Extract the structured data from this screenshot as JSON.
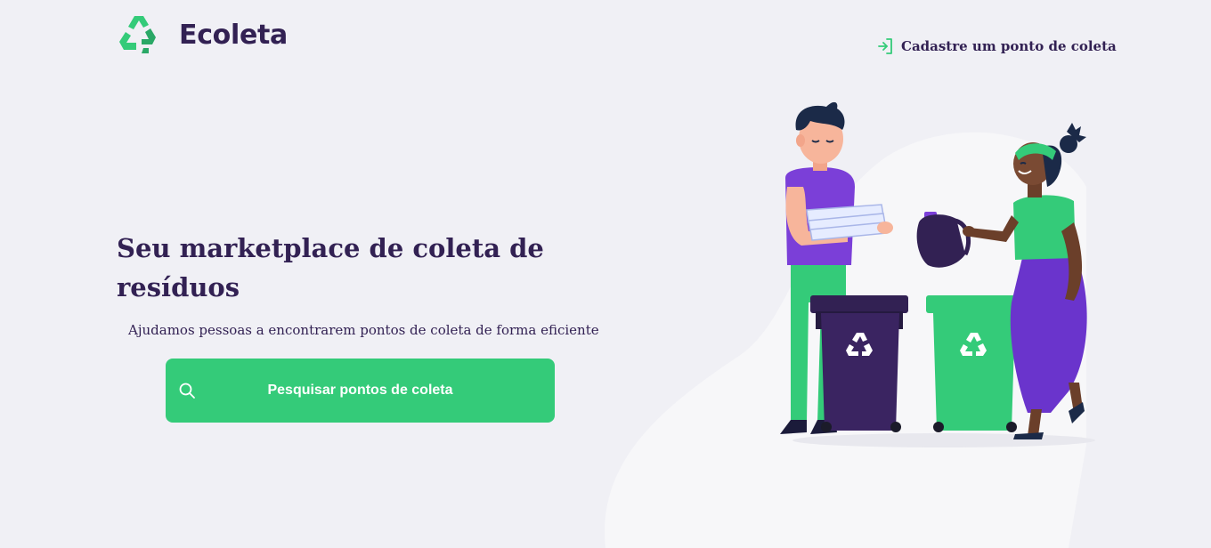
{
  "brand": {
    "name": "Ecoleta",
    "icon": "recycle-icon"
  },
  "header": {
    "register_link": "Cadastre um ponto de coleta",
    "register_icon": "log-in-icon"
  },
  "hero": {
    "title": "Seu marketplace de coleta de resíduos",
    "subtitle": "Ajudamos pessoas a encontrarem pontos de coleta de forma eficiente",
    "search_button": "Pesquisar pontos de coleta",
    "search_icon": "search-icon"
  },
  "colors": {
    "background": "#F0F0F5",
    "primary": "#34CB79",
    "title": "#322153",
    "accent_purple": "#6C3FD1"
  }
}
